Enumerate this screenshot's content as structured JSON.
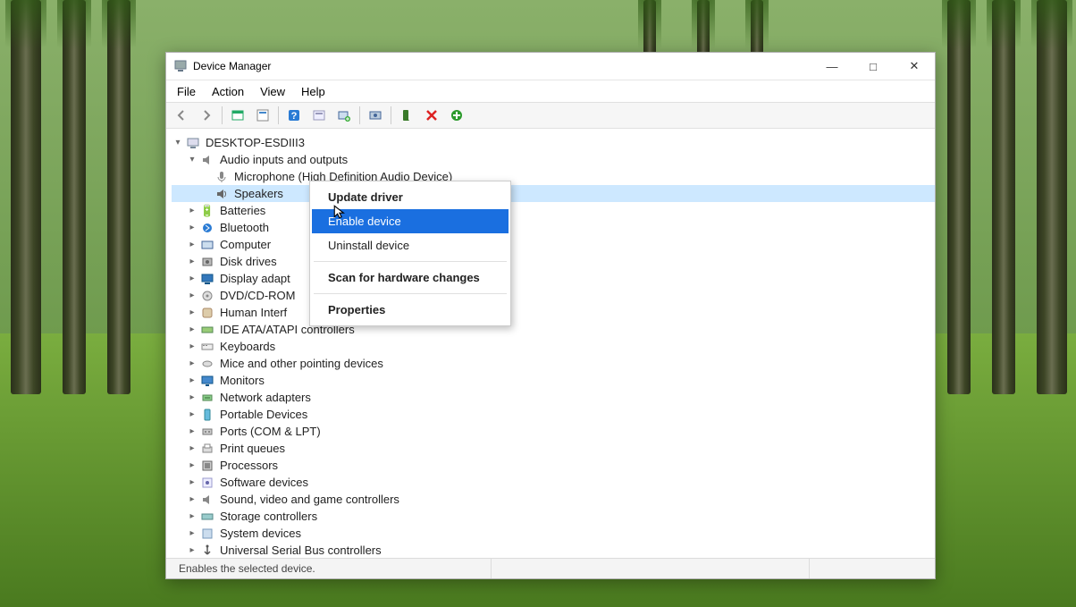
{
  "window": {
    "title": "Device Manager",
    "controls": {
      "minimize": "—",
      "maximize": "□",
      "close": "✕"
    }
  },
  "menubar": [
    "File",
    "Action",
    "View",
    "Help"
  ],
  "toolbar_icons": [
    "back",
    "forward",
    "show-all",
    "properties",
    "help",
    "action-center",
    "update-driver",
    "uninstall",
    "scan-hw",
    "disable",
    "remove",
    "add"
  ],
  "tree": {
    "root": "DESKTOP-ESDIII3",
    "audio": {
      "label": "Audio inputs and outputs",
      "mic": "Microphone (High Definition Audio Device)",
      "speakers": "Speakers"
    },
    "categories": [
      "Batteries",
      "Bluetooth",
      "Computer",
      "Disk drives",
      "Display adapt",
      "DVD/CD-ROM",
      "Human Interf",
      "IDE ATA/ATAPI controllers",
      "Keyboards",
      "Mice and other pointing devices",
      "Monitors",
      "Network adapters",
      "Portable Devices",
      "Ports (COM & LPT)",
      "Print queues",
      "Processors",
      "Software devices",
      "Sound, video and game controllers",
      "Storage controllers",
      "System devices",
      "Universal Serial Bus controllers"
    ]
  },
  "context_menu": {
    "items": [
      {
        "label": "Update driver",
        "bold": true
      },
      {
        "label": "Enable device",
        "highlight": true
      },
      {
        "label": "Uninstall device"
      },
      {
        "sep": true
      },
      {
        "label": "Scan for hardware changes",
        "bold": true
      },
      {
        "sep": true
      },
      {
        "label": "Properties",
        "bold": true
      }
    ]
  },
  "statusbar": "Enables the selected device."
}
